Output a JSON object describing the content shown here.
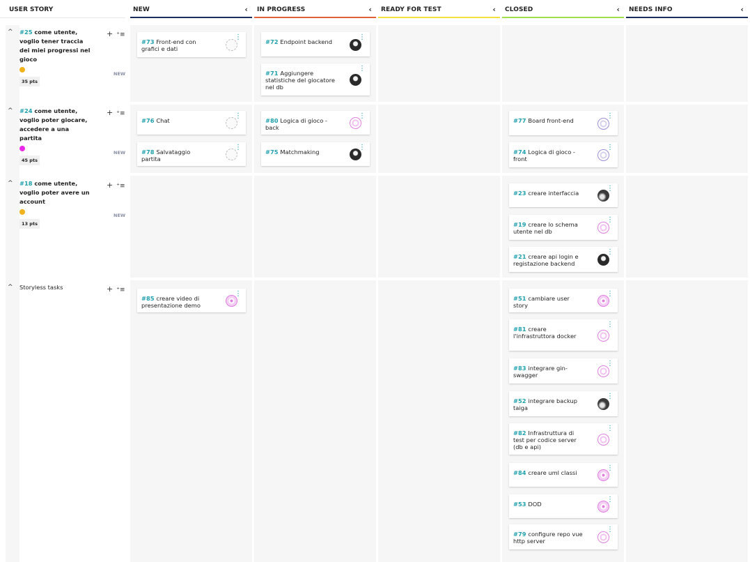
{
  "columns": [
    {
      "label": "NEW",
      "color": "#1a2b5e"
    },
    {
      "label": "IN PROGRESS",
      "color": "#e0603a"
    },
    {
      "label": "READY FOR TEST",
      "color": "#f3e03c"
    },
    {
      "label": "CLOSED",
      "color": "#9fe04a"
    },
    {
      "label": "NEEDS INFO",
      "color": "#1a2b5e"
    }
  ],
  "collapse_glyph": "‹",
  "user_story_header": "USER STORY",
  "user_stories": [
    {
      "ref": "#25",
      "title": "come utente, voglio tener traccia dei miei progressi nel gioco",
      "dot_color": "#f0b31e",
      "points": "35 pts",
      "status": "NEW"
    },
    {
      "ref": "#24",
      "title": "come utente, voglio poter giocare, accedere a una partita",
      "dot_color": "#ea2ae8",
      "points": "45 pts",
      "status": "NEW"
    },
    {
      "ref": "#18",
      "title": "come utente, voglio poter avere un account",
      "dot_color": "#f0b31e",
      "points": "13 pts",
      "status": "NEW"
    },
    {
      "ref": "",
      "title": "Storyless tasks",
      "dot_color": "",
      "points": "",
      "status": ""
    }
  ],
  "icons": {
    "toggle": "^",
    "add": "+",
    "add_bulk": "⁺≡",
    "menu": "⋮"
  },
  "tasks": [
    {
      "ref": "#73",
      "text": "Front-end con grafici e dati",
      "avatar": "empty"
    },
    {
      "ref": "#72",
      "text": "Endpoint backend",
      "avatar": "dark"
    },
    {
      "ref": "#71",
      "text": "Aggiungere statistiche del giocatore nel db",
      "avatar": "dark"
    },
    {
      "ref": "#76",
      "text": "Chat",
      "avatar": "empty"
    },
    {
      "ref": "#78",
      "text": "Salvataggio partita",
      "avatar": "empty"
    },
    {
      "ref": "#80",
      "text": "Logica di gioco - back",
      "avatar": "pink"
    },
    {
      "ref": "#75",
      "text": "Matchmaking",
      "avatar": "dark"
    },
    {
      "ref": "#77",
      "text": "Board front-end",
      "avatar": "purple"
    },
    {
      "ref": "#74",
      "text": "Logica di gioco - front",
      "avatar": "purple"
    },
    {
      "ref": "#23",
      "text": "creare interfaccia",
      "avatar": "gray"
    },
    {
      "ref": "#19",
      "text": "creare lo schema utente nel db",
      "avatar": "pink"
    },
    {
      "ref": "#21",
      "text": "creare api login e registazione backend",
      "avatar": "dark"
    },
    {
      "ref": "#85",
      "text": "creare video di presentazione demo",
      "avatar": "pink2"
    },
    {
      "ref": "#51",
      "text": "cambiare user story",
      "avatar": "pink2"
    },
    {
      "ref": "#81",
      "text": "creare l'infrastruttora docker",
      "avatar": "pink"
    },
    {
      "ref": "#83",
      "text": "integrare gin-swagger",
      "avatar": "pink"
    },
    {
      "ref": "#52",
      "text": "integrare backup taiga",
      "avatar": "gray"
    },
    {
      "ref": "#82",
      "text": "Infrastruttura di test per codice server (db e api)",
      "avatar": "pink"
    },
    {
      "ref": "#84",
      "text": "creare uml classi",
      "avatar": "pink2"
    },
    {
      "ref": "#53",
      "text": "DOD",
      "avatar": "pink2"
    },
    {
      "ref": "#79",
      "text": "configure repo vue http server",
      "avatar": "pink"
    }
  ]
}
